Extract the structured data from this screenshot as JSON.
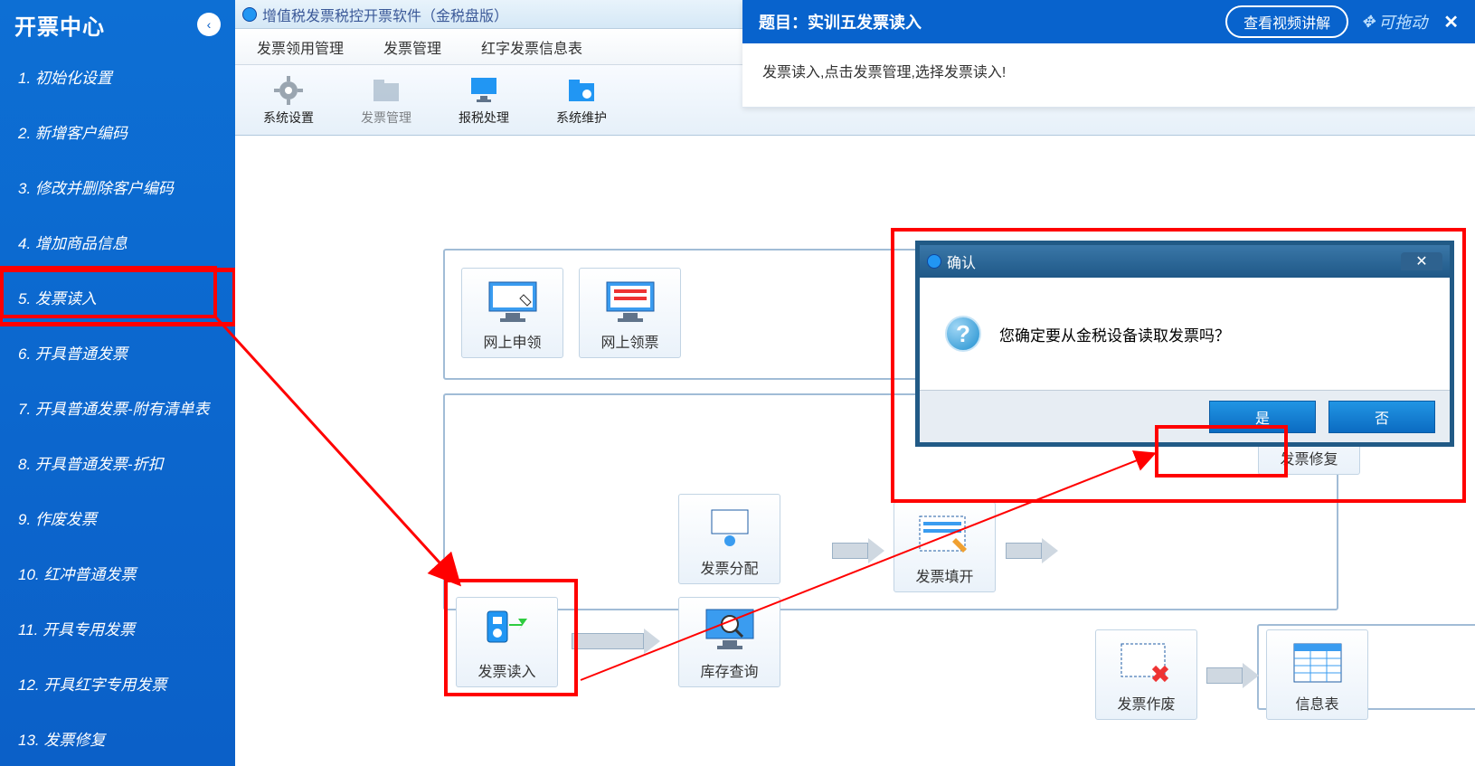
{
  "sidebar": {
    "title": "开票中心",
    "items": [
      "1.  初始化设置",
      "2.  新增客户编码",
      "3.  修改并删除客户编码",
      "4.  增加商品信息",
      "5.  发票读入",
      "6.  开具普通发票",
      "7.  开具普通发票-附有清单表",
      "8.  开具普通发票-折扣",
      "9.  作废发票",
      "10.  红冲普通发票",
      "11.  开具专用发票",
      "12.  开具红字专用发票",
      "13.  发票修复"
    ],
    "highlight_index": 4
  },
  "app": {
    "title": "增值税发票税控开票软件（金税盘版）",
    "menu": [
      "发票领用管理",
      "发票管理",
      "红字发票信息表"
    ],
    "tools": [
      {
        "label": "系统设置",
        "icon": "gear",
        "disabled": false
      },
      {
        "label": "发票管理",
        "icon": "folder",
        "disabled": true
      },
      {
        "label": "报税处理",
        "icon": "monitor",
        "disabled": false
      },
      {
        "label": "系统维护",
        "icon": "folder-gear",
        "disabled": false
      }
    ]
  },
  "tiles": {
    "row1": [
      "网上申领",
      "网上领票"
    ],
    "distribution": "发票分配",
    "read_in": "发票读入",
    "stock_query": "库存查询",
    "fill": "发票填开",
    "repair": "发票修复",
    "void": "发票作废",
    "info_table": "信息表"
  },
  "dialog": {
    "title": "确认",
    "message": "您确定要从金税设备读取发票吗？",
    "yes": "是",
    "no": "否"
  },
  "topic": {
    "title": "题目：实训五发票读入",
    "view_btn": "查看视频讲解",
    "drag_hint": "可拖动",
    "body": "发票读入,点击发票管理,选择发票读入!"
  }
}
